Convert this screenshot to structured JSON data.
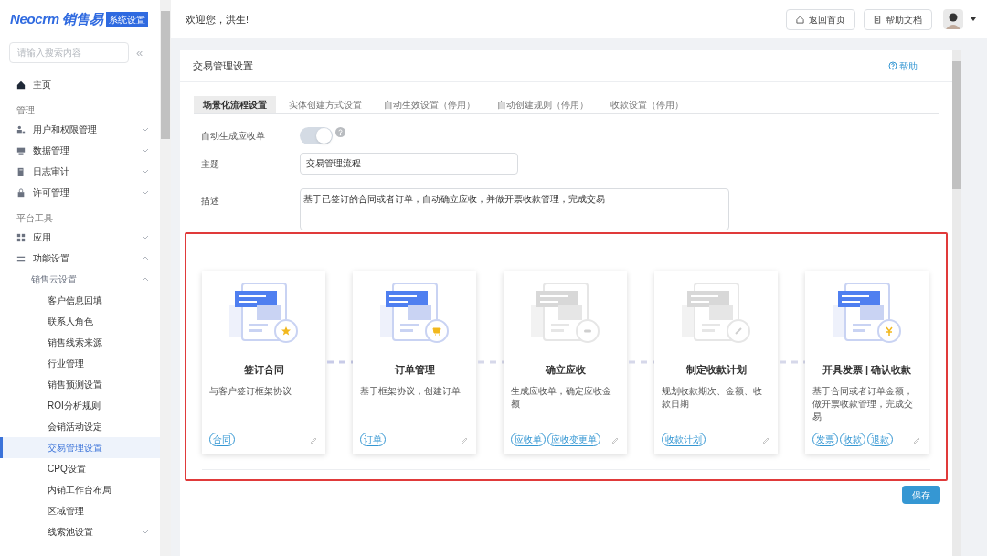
{
  "logo": {
    "brand": "Neocrm 销售易",
    "badge": "系统设置"
  },
  "sidebar": {
    "search": {
      "placeholder": "请输入搜索内容"
    },
    "collapse": "«",
    "sections": [
      {
        "items": [
          {
            "label": "主页",
            "kind": "home",
            "selected": false
          }
        ]
      },
      {
        "heading": "管理",
        "items": [
          {
            "label": "用户和权限管理",
            "kind": "users",
            "expanded": false,
            "selected": false
          },
          {
            "label": "数据管理",
            "kind": "data",
            "expanded": false,
            "selected": false
          },
          {
            "label": "日志审计",
            "kind": "log",
            "expanded": false,
            "selected": false
          },
          {
            "label": "许可管理",
            "kind": "lock",
            "expanded": false,
            "selected": false
          }
        ]
      },
      {
        "heading": "平台工具",
        "items": [
          {
            "label": "应用",
            "kind": "apps",
            "expanded": false,
            "selected": false
          },
          {
            "label": "功能设置",
            "kind": "settings",
            "expanded": true,
            "selected": false,
            "children": [
              {
                "label": "销售云设置",
                "expanded": true,
                "selected": false,
                "children": [
                  {
                    "label": "客户信息回填",
                    "selected": false
                  },
                  {
                    "label": "联系人角色",
                    "selected": false
                  },
                  {
                    "label": "销售线索来源",
                    "selected": false
                  },
                  {
                    "label": "行业管理",
                    "selected": false
                  },
                  {
                    "label": "销售预测设置",
                    "selected": false
                  },
                  {
                    "label": "ROI分析规则",
                    "selected": false
                  },
                  {
                    "label": "会销活动设定",
                    "selected": false
                  },
                  {
                    "label": "交易管理设置",
                    "selected": true
                  },
                  {
                    "label": "CPQ设置",
                    "selected": false
                  },
                  {
                    "label": "内销工作台布局",
                    "selected": false
                  },
                  {
                    "label": "区域管理",
                    "selected": false
                  },
                  {
                    "label": "线索池设置",
                    "selected": false,
                    "expanded": false
                  }
                ]
              }
            ]
          }
        ]
      }
    ]
  },
  "header": {
    "greeting": "欢迎您，洪生!",
    "buttons": [
      {
        "label": "返回首页",
        "kind": "home"
      },
      {
        "label": "帮助文档",
        "kind": "doc"
      }
    ]
  },
  "panel": {
    "title": "交易管理设置",
    "help": "帮助",
    "tabs": [
      {
        "label": "场景化流程设置",
        "selected": true
      },
      {
        "label": "实体创建方式设置",
        "selected": false
      },
      {
        "label": "自动生效设置（停用）",
        "selected": false
      },
      {
        "label": "自动创建规则（停用）",
        "selected": false
      },
      {
        "label": "收款设置（停用）",
        "selected": false
      }
    ],
    "auto_receivable": {
      "label": "自动生成应收单",
      "on": true,
      "disabled": true
    },
    "subject": {
      "label": "主题",
      "value": "交易管理流程"
    },
    "description": {
      "label": "描述",
      "value": "基于已签订的合同或者订单，自动确立应收，并做开票收款管理，完成交易"
    },
    "steps": [
      {
        "title": "签订合同",
        "text": "与客户签订框架协议",
        "tags": [
          "合同"
        ],
        "enabled": true
      },
      {
        "title": "订单管理",
        "text": "基于框架协议，创建订单",
        "tags": [
          "订单"
        ],
        "enabled": true
      },
      {
        "title": "确立应收",
        "text": "生成应收单，确定应收金额",
        "tags": [
          "应收单",
          "应收变更单"
        ],
        "enabled": false
      },
      {
        "title": "制定收款计划",
        "text": "规划收款期次、金额、收款日期",
        "tags": [
          "收款计划"
        ],
        "enabled": false
      },
      {
        "title": "开具发票 | 确认收款",
        "text": "基于合同或者订单金额，做开票收款管理，完成交易",
        "tags": [
          "发票",
          "收款",
          "退款"
        ],
        "enabled": true
      }
    ],
    "save": "保存"
  }
}
